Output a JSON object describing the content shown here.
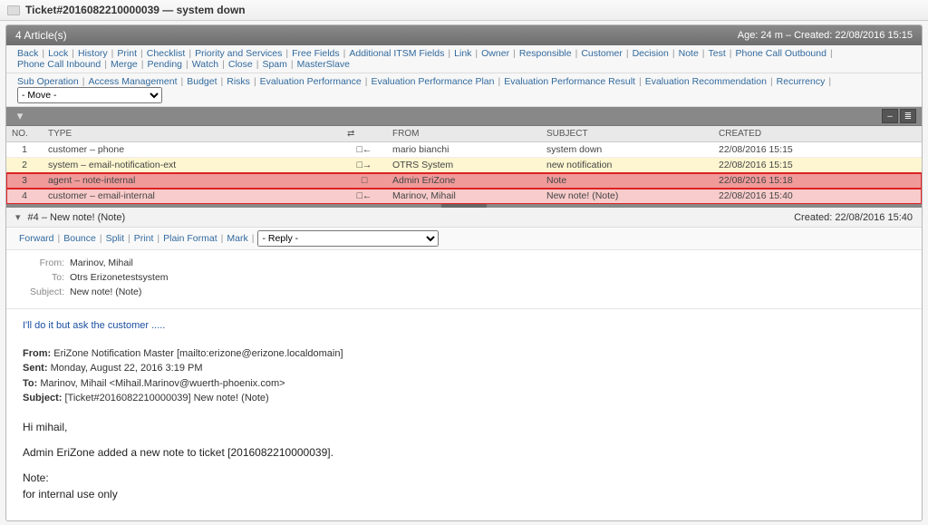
{
  "window": {
    "title": "Ticket#2016082210000039 — system down"
  },
  "header": {
    "article_count": "4 Article(s)",
    "age_created": "Age: 24 m – Created: 22/08/2016 15:15"
  },
  "toolbar1": [
    "Back",
    "Lock",
    "History",
    "Print",
    "Checklist",
    "Priority and Services",
    "Free Fields",
    "Additional ITSM Fields",
    "Link",
    "Owner",
    "Responsible",
    "Customer",
    "Decision",
    "Note",
    "Test",
    "Phone Call Outbound",
    "Phone Call Inbound",
    "Merge",
    "Pending",
    "Watch",
    "Close",
    "Spam",
    "MasterSlave"
  ],
  "toolbar2": [
    "Sub Operation",
    "Access Management",
    "Budget",
    "Risks",
    "Evaluation Performance",
    "Evaluation Performance Plan",
    "Evaluation Performance Result",
    "Evaluation Recommendation",
    "Recurrency"
  ],
  "move_select": "- Move -",
  "columns": {
    "no": "NO.",
    "type": "TYPE",
    "from": "FROM",
    "subject": "SUBJECT",
    "created": "CREATED"
  },
  "articles": [
    {
      "no": "1",
      "type": "customer – phone",
      "dir": "□←",
      "from": "mario bianchi",
      "subject": "system down",
      "created": "22/08/2016 15:15",
      "cls": "row-default"
    },
    {
      "no": "2",
      "type": "system – email-notification-ext",
      "dir": "□→",
      "from": "OTRS System",
      "subject": "new notification",
      "created": "22/08/2016 15:15",
      "cls": "row-yellow"
    },
    {
      "no": "3",
      "type": "agent – note-internal",
      "dir": "□",
      "from": "Admin EriZone",
      "subject": "Note",
      "created": "22/08/2016 15:18",
      "cls": "row-red"
    },
    {
      "no": "4",
      "type": "customer – email-internal",
      "dir": "□←",
      "from": "Marinov, Mihail",
      "subject": "New note! (Note)",
      "created": "22/08/2016 15:40",
      "cls": "row-pink"
    }
  ],
  "article_view": {
    "title": "#4 – New note! (Note)",
    "created": "Created: 22/08/2016 15:40",
    "toolbar": [
      "Forward",
      "Bounce",
      "Split",
      "Print",
      "Plain Format",
      "Mark"
    ],
    "reply_select": "- Reply -",
    "meta": {
      "from_label": "From:",
      "from": "Marinov, Mihail",
      "to_label": "To:",
      "to": "Otrs Erizonetestsystem",
      "subject_label": "Subject:",
      "subject": "New note! (Note)"
    },
    "body": {
      "intro": "I'll do it but ask the customer .....",
      "q_from_lbl": "From:",
      "q_from": "EriZone Notification Master [mailto:erizone@erizone.localdomain]",
      "q_sent_lbl": "Sent:",
      "q_sent": "Monday, August 22, 2016 3:19 PM",
      "q_to_lbl": "To:",
      "q_to": "Marinov, Mihail <Mihail.Marinov@wuerth-phoenix.com>",
      "q_subj_lbl": "Subject:",
      "q_subj": "[Ticket#2016082210000039] New note! (Note)",
      "greeting": "Hi mihail,",
      "line1": "Admin EriZone added a new note to ticket [2016082210000039].",
      "note_lbl": "Note:",
      "note_body": "for internal use only"
    }
  }
}
